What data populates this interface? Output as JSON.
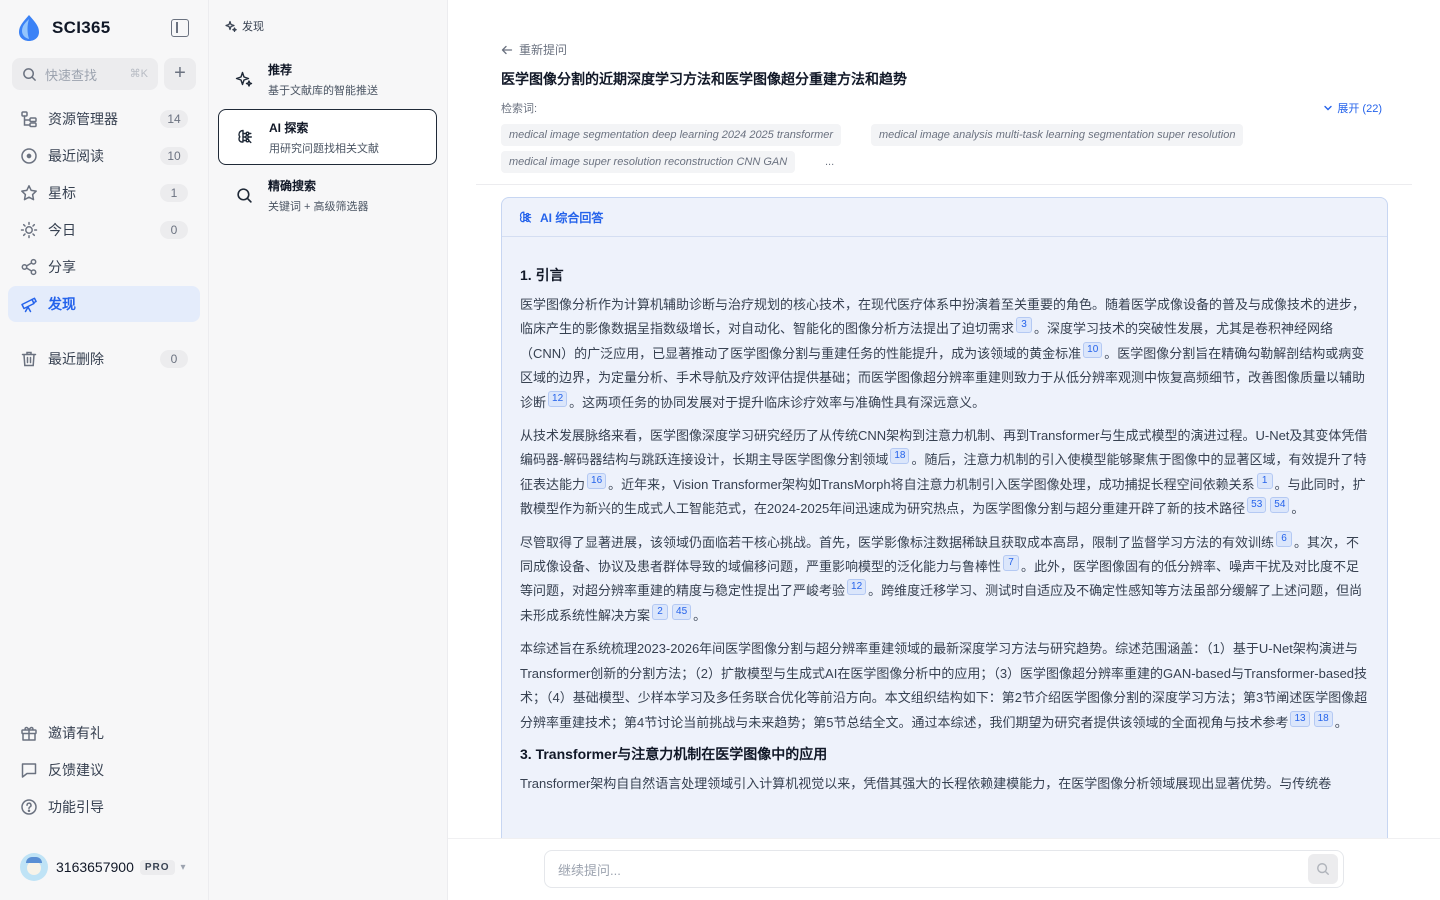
{
  "app": {
    "name": "SCI365",
    "search_placeholder": "快速查找",
    "search_shortcut": "⌘K"
  },
  "sidebar": {
    "items": [
      {
        "label": "资源管理器",
        "count": "14",
        "icon": "folder-tree-icon"
      },
      {
        "label": "最近阅读",
        "count": "10",
        "icon": "recent-reading-icon"
      },
      {
        "label": "星标",
        "count": "1",
        "icon": "star-icon"
      },
      {
        "label": "今日",
        "count": "0",
        "icon": "sun-icon"
      },
      {
        "label": "分享",
        "icon": "share-icon"
      },
      {
        "label": "发现",
        "icon": "telescope-icon",
        "active": true
      },
      {
        "label": "最近删除",
        "count": "0",
        "icon": "trash-icon"
      }
    ],
    "bottom_items": [
      {
        "label": "邀请有礼",
        "icon": "gift-icon"
      },
      {
        "label": "反馈建议",
        "icon": "feedback-icon"
      },
      {
        "label": "功能引导",
        "icon": "help-icon"
      }
    ],
    "user": {
      "name": "3163657900",
      "badge": "PRO"
    }
  },
  "mode_panel": {
    "title": "发现",
    "modes": [
      {
        "name": "推荐",
        "desc": "基于文献库的智能推送",
        "icon": "sparkles-icon"
      },
      {
        "name": "AI 探索",
        "desc": "用研究问题找相关文献",
        "icon": "ai-brain-icon",
        "active": true
      },
      {
        "name": "精确搜索",
        "desc": "关键词 + 高级筛选器",
        "icon": "search-icon"
      }
    ]
  },
  "main": {
    "back_label": "重新提问",
    "question": "医学图像分割的近期深度学习方法和医学图像超分重建方法和趋势",
    "keywords_label": "检索词:",
    "expand_label": "展开 (22)",
    "keywords": [
      "medical image segmentation deep learning 2024 2025 transformer",
      "medical image analysis multi-task learning segmentation super resolution",
      "medical image super resolution reconstruction CNN GAN",
      "..."
    ],
    "answer_title": "AI 综合回答",
    "sections": [
      {
        "heading": "1. 引言",
        "paragraphs": [
          [
            {
              "t": "医学图像分析作为计算机辅助诊断与治疗规划的核心技术，在现代医疗体系中扮演着至关重要的角色。随着医学成像设备的普及与成像技术的进步，临床产生的影像数据呈指数级增长，对自动化、智能化的图像分析方法提出了迫切需求"
            },
            {
              "c": "3"
            },
            {
              "t": "。深度学习技术的突破性发展，尤其是卷积神经网络（CNN）的广泛应用，已显著推动了医学图像分割与重建任务的性能提升，成为该领域的黄金标准"
            },
            {
              "c": "10"
            },
            {
              "t": "。医学图像分割旨在精确勾勒解剖结构或病变区域的边界，为定量分析、手术导航及疗效评估提供基础；而医学图像超分辨率重建则致力于从低分辨率观测中恢复高频细节，改善图像质量以辅助诊断"
            },
            {
              "c": "12"
            },
            {
              "t": "。这两项任务的协同发展对于提升临床诊疗效率与准确性具有深远意义。"
            }
          ],
          [
            {
              "t": "从技术发展脉络来看，医学图像深度学习研究经历了从传统CNN架构到注意力机制、再到Transformer与生成式模型的演进过程。U-Net及其变体凭借编码器-解码器结构与跳跃连接设计，长期主导医学图像分割领域"
            },
            {
              "c": "18"
            },
            {
              "t": "。随后，注意力机制的引入使模型能够聚焦于图像中的显著区域，有效提升了特征表达能力"
            },
            {
              "c": "16"
            },
            {
              "t": "。近年来，Vision Transformer架构如TransMorph将自注意力机制引入医学图像处理，成功捕捉长程空间依赖关系"
            },
            {
              "c": "1"
            },
            {
              "t": "。与此同时，扩散模型作为新兴的生成式人工智能范式，在2024-2025年间迅速成为研究热点，为医学图像分割与超分重建开辟了新的技术路径"
            },
            {
              "c": "53"
            },
            {
              "c": "54"
            },
            {
              "t": "。"
            }
          ],
          [
            {
              "t": "尽管取得了显著进展，该领域仍面临若干核心挑战。首先，医学影像标注数据稀缺且获取成本高昂，限制了监督学习方法的有效训练"
            },
            {
              "c": "6"
            },
            {
              "t": "。其次，不同成像设备、协议及患者群体导致的域偏移问题，严重影响模型的泛化能力与鲁棒性"
            },
            {
              "c": "7"
            },
            {
              "t": "。此外，医学图像固有的低分辨率、噪声干扰及对比度不足等问题，对超分辨率重建的精度与稳定性提出了严峻考验"
            },
            {
              "c": "12"
            },
            {
              "t": "。跨维度迁移学习、测试时自适应及不确定性感知等方法虽部分缓解了上述问题，但尚未形成系统性解决方案"
            },
            {
              "c": "2"
            },
            {
              "c": "45"
            },
            {
              "t": "。"
            }
          ],
          [
            {
              "t": "本综述旨在系统梳理2023-2026年间医学图像分割与超分辨率重建领域的最新深度学习方法与研究趋势。综述范围涵盖：（1）基于U-Net架构演进与Transformer创新的分割方法；（2）扩散模型与生成式AI在医学图像分析中的应用；（3）医学图像超分辨率重建的GAN-based与Transformer-based技术；（4）基础模型、少样本学习及多任务联合优化等前沿方向。本文组织结构如下：第2节介绍医学图像分割的深度学习方法；第3节阐述医学图像超分辨率重建技术；第4节讨论当前挑战与未来趋势；第5节总结全文。通过本综述，我们期望为研究者提供该领域的全面视角与技术参考"
            },
            {
              "c": "13"
            },
            {
              "c": "18"
            },
            {
              "t": "。"
            }
          ]
        ]
      },
      {
        "heading": "3. Transformer与注意力机制在医学图像中的应用",
        "paragraphs": [
          [
            {
              "t": "Transformer架构自自然语言处理领域引入计算机视觉以来，凭借其强大的长程依赖建模能力，在医学图像分析领域展现出显著优势。与传统卷"
            }
          ]
        ]
      }
    ],
    "composer_placeholder": "继续提问..."
  }
}
